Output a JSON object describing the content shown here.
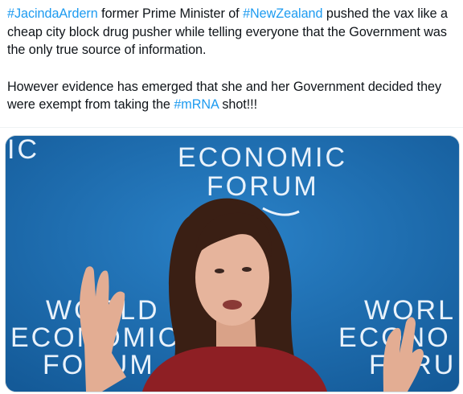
{
  "tweet": {
    "line1": {
      "tag1": "#JacindaArdern",
      "text1": " former Prime Minister of ",
      "tag2": "#NewZealand",
      "text2": " pushed the vax like a cheap city block drug pusher while telling everyone that the Government was the only true source of information."
    },
    "line2": {
      "text1": "However evidence has emerged that she and her Government decided they were exempt from taking the ",
      "tag": "#mRNA",
      "text2": " shot!!!"
    }
  },
  "media": {
    "backdrop_text_top_left": "IC",
    "backdrop_line1": "ECONOMIC",
    "backdrop_line2": "FORUM",
    "backdrop_left_1": "WORLD",
    "backdrop_left_2": "ECONOMIC",
    "backdrop_left_3": "FORUM",
    "backdrop_right_1": "WORL",
    "backdrop_right_2": "ECONO",
    "backdrop_right_3": "FORU",
    "colors": {
      "backdrop": "#1e6fb4",
      "backdrop_dark": "#145a98",
      "hair": "#3a1f14",
      "skin": "#e6b49c",
      "dress": "#8e1f24"
    }
  }
}
